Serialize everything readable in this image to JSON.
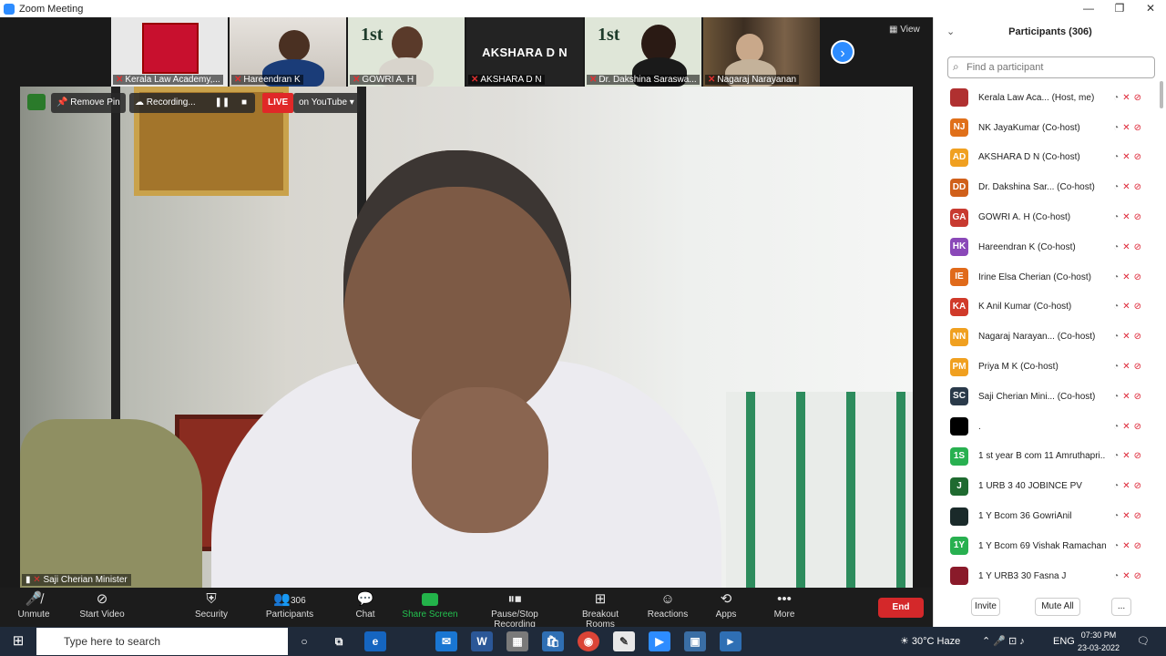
{
  "window": {
    "title": "Zoom Meeting",
    "min": "—",
    "max": "❐",
    "close": "✕"
  },
  "strip": {
    "tiles": [
      {
        "name": "Kerala Law Academy,..."
      },
      {
        "name": "Hareendran K"
      },
      {
        "name": "GOWRI A. H",
        "poster": "1st"
      },
      {
        "name": "AKSHARA D N",
        "big": "AKSHARA D N"
      },
      {
        "name": "Dr. Dakshina Saraswa...",
        "poster": "1st"
      },
      {
        "name": "Nagaraj Narayanan"
      }
    ],
    "next_glyph": "›",
    "view_label": "View"
  },
  "main": {
    "remove_pin": "Remove Pin",
    "recording": "Recording...",
    "live": "LIVE",
    "on_youtube": "on YouTube ▾",
    "speaker": "Saji Cherian Minister"
  },
  "toolbar": {
    "unmute": "Unmute",
    "start_video": "Start Video",
    "security": "Security",
    "participants": "Participants",
    "participants_count": "306",
    "chat": "Chat",
    "share_screen": "Share Screen",
    "pause_stop": "Pause/Stop Recording",
    "breakout": "Breakout Rooms",
    "reactions": "Reactions",
    "apps": "Apps",
    "more": "More",
    "end": "End"
  },
  "panel": {
    "title": "Participants (306)",
    "search_placeholder": "Find a participant",
    "participants": [
      {
        "initials": "",
        "name": "Kerala Law Aca...  (Host, me)",
        "color": "#b03030"
      },
      {
        "initials": "NJ",
        "name": "NK JayaKumar (Co-host)",
        "color": "#e0701a"
      },
      {
        "initials": "AD",
        "name": "AKSHARA D N (Co-host)",
        "color": "#f0a020"
      },
      {
        "initials": "DD",
        "name": "Dr. Dakshina Sar...  (Co-host)",
        "color": "#d0601a"
      },
      {
        "initials": "GA",
        "name": "GOWRI A. H (Co-host)",
        "color": "#c83a30"
      },
      {
        "initials": "HK",
        "name": "Hareendran K (Co-host)",
        "color": "#8a48b8"
      },
      {
        "initials": "IE",
        "name": "Irine Elsa Cherian (Co-host)",
        "color": "#e06a1a"
      },
      {
        "initials": "KA",
        "name": "K Anil Kumar (Co-host)",
        "color": "#d03a2a"
      },
      {
        "initials": "NN",
        "name": "Nagaraj Narayan...  (Co-host)",
        "color": "#f0a020"
      },
      {
        "initials": "PM",
        "name": "Priya M K (Co-host)",
        "color": "#f0a020"
      },
      {
        "initials": "SC",
        "name": "Saji Cherian Mini...  (Co-host)",
        "color": "#2a3a4a"
      },
      {
        "initials": "",
        "name": ".",
        "color": "#000000"
      },
      {
        "initials": "1S",
        "name": "1 st year B com  11 Amruthapri...",
        "color": "#28b050"
      },
      {
        "initials": "J",
        "name": "1 URB 3 40 JOBINCE PV",
        "color": "#1f6a30"
      },
      {
        "initials": "",
        "name": "1 Y Bcom 36 GowriAnil",
        "color": "#1a2a2a"
      },
      {
        "initials": "1Y",
        "name": "1 Y Bcom 69 Vishak Ramachan...",
        "color": "#28b050"
      },
      {
        "initials": "",
        "name": "1 Y URB3 30 Fasna J",
        "color": "#8a1a2a"
      }
    ],
    "invite": "Invite",
    "mute_all": "Mute All",
    "more": "..."
  },
  "taskbar": {
    "search_placeholder": "Type here to search",
    "weather": "30°C  Haze",
    "lang": "ENG",
    "time": "07:30 PM",
    "date": "23-03-2022"
  }
}
